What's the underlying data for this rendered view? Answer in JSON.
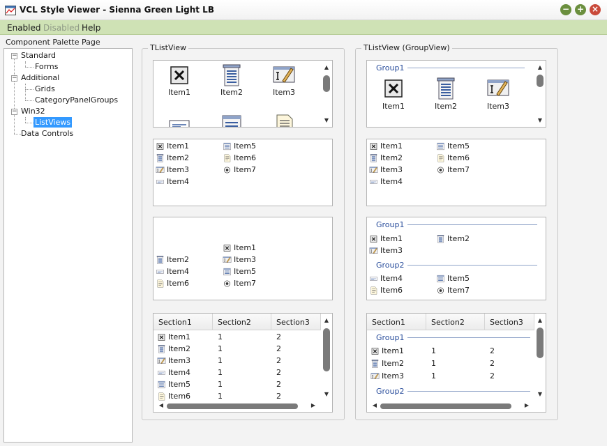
{
  "window": {
    "title": "VCL Style Viewer - Sienna Green Light LB",
    "minimize": "−",
    "maximize": "+",
    "close": "×"
  },
  "menu": {
    "enabled": "Enabled",
    "disabled": "Disabled",
    "help": "Help"
  },
  "palette": {
    "label": "Component Palette Page"
  },
  "tree": [
    {
      "label": "Standard",
      "expander": "−"
    },
    {
      "label": "Forms"
    },
    {
      "label": "Additional",
      "expander": "−"
    },
    {
      "label": "Grids"
    },
    {
      "label": "CategoryPanelGroups"
    },
    {
      "label": "Win32",
      "expander": "−"
    },
    {
      "label": "ListViews",
      "selected": true
    },
    {
      "label": "Data Controls"
    }
  ],
  "left_panel": {
    "title": "TListView"
  },
  "right_panel": {
    "title": "TListView (GroupView)"
  },
  "items": [
    "Item1",
    "Item2",
    "Item3",
    "Item4",
    "Item5",
    "Item6",
    "Item7"
  ],
  "groups": [
    "Group1",
    "Group2"
  ],
  "columns": [
    "Section1",
    "Section2",
    "Section3"
  ],
  "report_rows": [
    {
      "name": "Item1",
      "s2": "1",
      "s3": "2"
    },
    {
      "name": "Item2",
      "s2": "1",
      "s3": "2"
    },
    {
      "name": "Item3",
      "s2": "1",
      "s3": "2"
    },
    {
      "name": "Item4",
      "s2": "1",
      "s3": "2"
    },
    {
      "name": "Item5",
      "s2": "1",
      "s3": "2"
    },
    {
      "name": "Item6",
      "s2": "1",
      "s3": "2"
    }
  ],
  "colors": {
    "menubar": "#cfe2b5",
    "selection": "#3399ff",
    "group_text": "#2a4e9c"
  },
  "icons": [
    "delete-box-icon",
    "list-form-icon",
    "edit-text-icon",
    "label-edit-icon",
    "grid-form-icon",
    "document-icon",
    "radio-icon"
  ]
}
